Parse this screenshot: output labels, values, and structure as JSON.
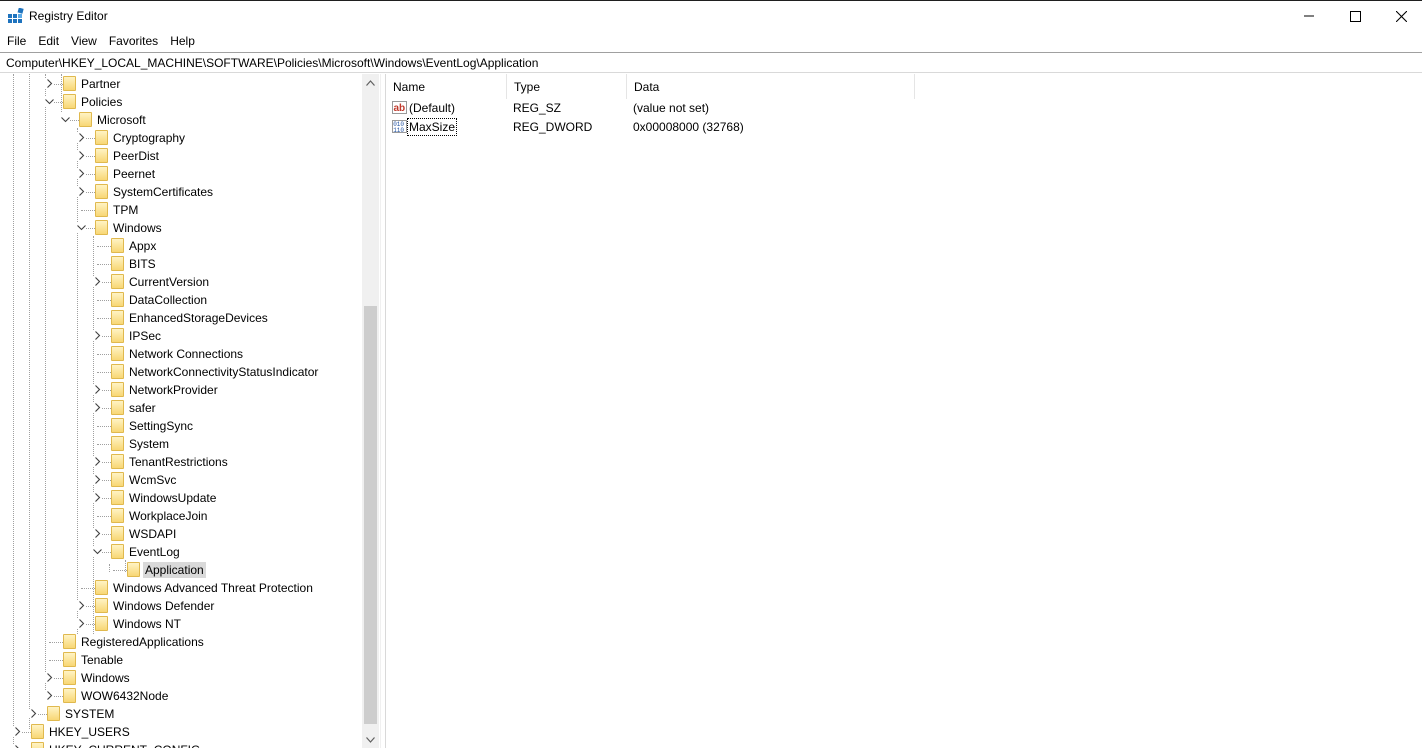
{
  "window": {
    "title": "Registry Editor"
  },
  "menu": [
    "File",
    "Edit",
    "View",
    "Favorites",
    "Help"
  ],
  "address": "Computer\\HKEY_LOCAL_MACHINE\\SOFTWARE\\Policies\\Microsoft\\Windows\\EventLog\\Application",
  "tree": [
    {
      "label": "Partner",
      "level": 3,
      "expander": "collapsed"
    },
    {
      "label": "Policies",
      "level": 3,
      "expander": "expanded"
    },
    {
      "label": "Microsoft",
      "level": 4,
      "expander": "expanded"
    },
    {
      "label": "Cryptography",
      "level": 5,
      "expander": "collapsed"
    },
    {
      "label": "PeerDist",
      "level": 5,
      "expander": "collapsed"
    },
    {
      "label": "Peernet",
      "level": 5,
      "expander": "collapsed"
    },
    {
      "label": "SystemCertificates",
      "level": 5,
      "expander": "collapsed"
    },
    {
      "label": "TPM",
      "level": 5,
      "expander": "none"
    },
    {
      "label": "Windows",
      "level": 5,
      "expander": "expanded"
    },
    {
      "label": "Appx",
      "level": 6,
      "expander": "none"
    },
    {
      "label": "BITS",
      "level": 6,
      "expander": "none"
    },
    {
      "label": "CurrentVersion",
      "level": 6,
      "expander": "collapsed"
    },
    {
      "label": "DataCollection",
      "level": 6,
      "expander": "none"
    },
    {
      "label": "EnhancedStorageDevices",
      "level": 6,
      "expander": "none"
    },
    {
      "label": "IPSec",
      "level": 6,
      "expander": "collapsed"
    },
    {
      "label": "Network Connections",
      "level": 6,
      "expander": "none"
    },
    {
      "label": "NetworkConnectivityStatusIndicator",
      "level": 6,
      "expander": "none"
    },
    {
      "label": "NetworkProvider",
      "level": 6,
      "expander": "collapsed"
    },
    {
      "label": "safer",
      "level": 6,
      "expander": "collapsed"
    },
    {
      "label": "SettingSync",
      "level": 6,
      "expander": "none"
    },
    {
      "label": "System",
      "level": 6,
      "expander": "none"
    },
    {
      "label": "TenantRestrictions",
      "level": 6,
      "expander": "collapsed"
    },
    {
      "label": "WcmSvc",
      "level": 6,
      "expander": "collapsed"
    },
    {
      "label": "WindowsUpdate",
      "level": 6,
      "expander": "collapsed"
    },
    {
      "label": "WorkplaceJoin",
      "level": 6,
      "expander": "none"
    },
    {
      "label": "WSDAPI",
      "level": 6,
      "expander": "collapsed"
    },
    {
      "label": "EventLog",
      "level": 6,
      "expander": "expanded"
    },
    {
      "label": "Application",
      "level": 7,
      "expander": "none",
      "selected": true
    },
    {
      "label": "Windows Advanced Threat Protection",
      "level": 5,
      "expander": "none"
    },
    {
      "label": "Windows Defender",
      "level": 5,
      "expander": "collapsed"
    },
    {
      "label": "Windows NT",
      "level": 5,
      "expander": "collapsed"
    },
    {
      "label": "RegisteredApplications",
      "level": 3,
      "expander": "none"
    },
    {
      "label": "Tenable",
      "level": 3,
      "expander": "none"
    },
    {
      "label": "Windows",
      "level": 3,
      "expander": "collapsed"
    },
    {
      "label": "WOW6432Node",
      "level": 3,
      "expander": "collapsed"
    },
    {
      "label": "SYSTEM",
      "level": 2,
      "expander": "collapsed"
    },
    {
      "label": "HKEY_USERS",
      "level": 1,
      "expander": "collapsed"
    },
    {
      "label": "HKEY_CURRENT_CONFIG",
      "level": 1,
      "expander": "collapsed"
    }
  ],
  "list": {
    "headers": {
      "name": "Name",
      "type": "Type",
      "data": "Data"
    },
    "rows": [
      {
        "name": "(Default)",
        "type": "REG_SZ",
        "data": "(value not set)",
        "icon": "string-value-icon"
      },
      {
        "name": "MaxSize",
        "type": "REG_DWORD",
        "data": "0x00008000 (32768)",
        "icon": "binary-value-icon",
        "focused": true
      }
    ]
  },
  "colors": {
    "folder_fill": "#f8d775",
    "selection": "#d9d9d9",
    "scrollbar_thumb": "#cdcdcd"
  }
}
